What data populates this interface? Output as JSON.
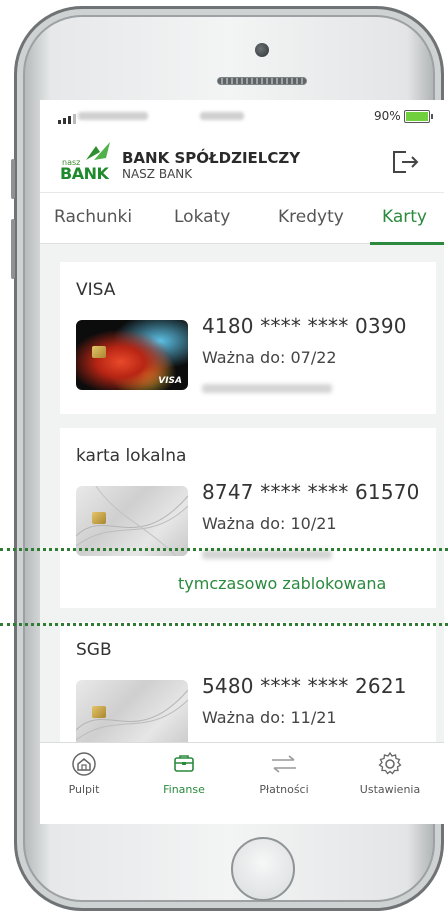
{
  "status_bar": {
    "battery": "90%",
    "battery_level": 0.9
  },
  "header": {
    "logo_small": "nasz",
    "logo_big": "BANK",
    "bank_name": "BANK SPÓŁDZIELCZY",
    "bank_subtitle": "NASZ BANK"
  },
  "tabs": [
    {
      "label": "Rachunki"
    },
    {
      "label": "Lokaty"
    },
    {
      "label": "Kredyty"
    },
    {
      "label": "Karty",
      "active": true
    }
  ],
  "cards": [
    {
      "title": "VISA",
      "number": "4180 **** **** 0390",
      "expiry": "Ważna do: 07/22",
      "brand_mark": "VISA"
    },
    {
      "title": "karta lokalna",
      "number": "8747 **** **** 61570",
      "expiry": "Ważna do: 10/21",
      "status": "tymczasowo zablokowana"
    },
    {
      "title": "SGB",
      "number": "5480 **** **** 2621",
      "expiry": "Ważna do: 11/21"
    }
  ],
  "bottom_nav": [
    {
      "label": "Pulpit",
      "icon": "home-icon"
    },
    {
      "label": "Finanse",
      "icon": "wallet-icon",
      "active": true
    },
    {
      "label": "Płatności",
      "icon": "transfer-icon"
    },
    {
      "label": "Ustawienia",
      "icon": "gear-icon"
    }
  ],
  "colors": {
    "accent": "#2b8a3e",
    "background": "#f1f2f2",
    "status_text": "#2b8a3e"
  }
}
